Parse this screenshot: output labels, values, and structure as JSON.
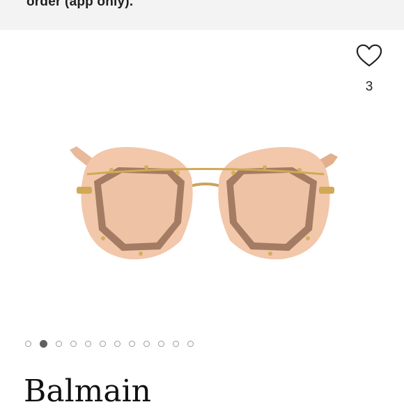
{
  "banner": {
    "text": "order (app only)."
  },
  "like": {
    "icon": "heart-icon",
    "count": "3"
  },
  "product": {
    "image_icon": "sunglasses-image"
  },
  "carousel": {
    "count": 12,
    "active_index": 1
  },
  "brand": {
    "name": "Balmain"
  }
}
